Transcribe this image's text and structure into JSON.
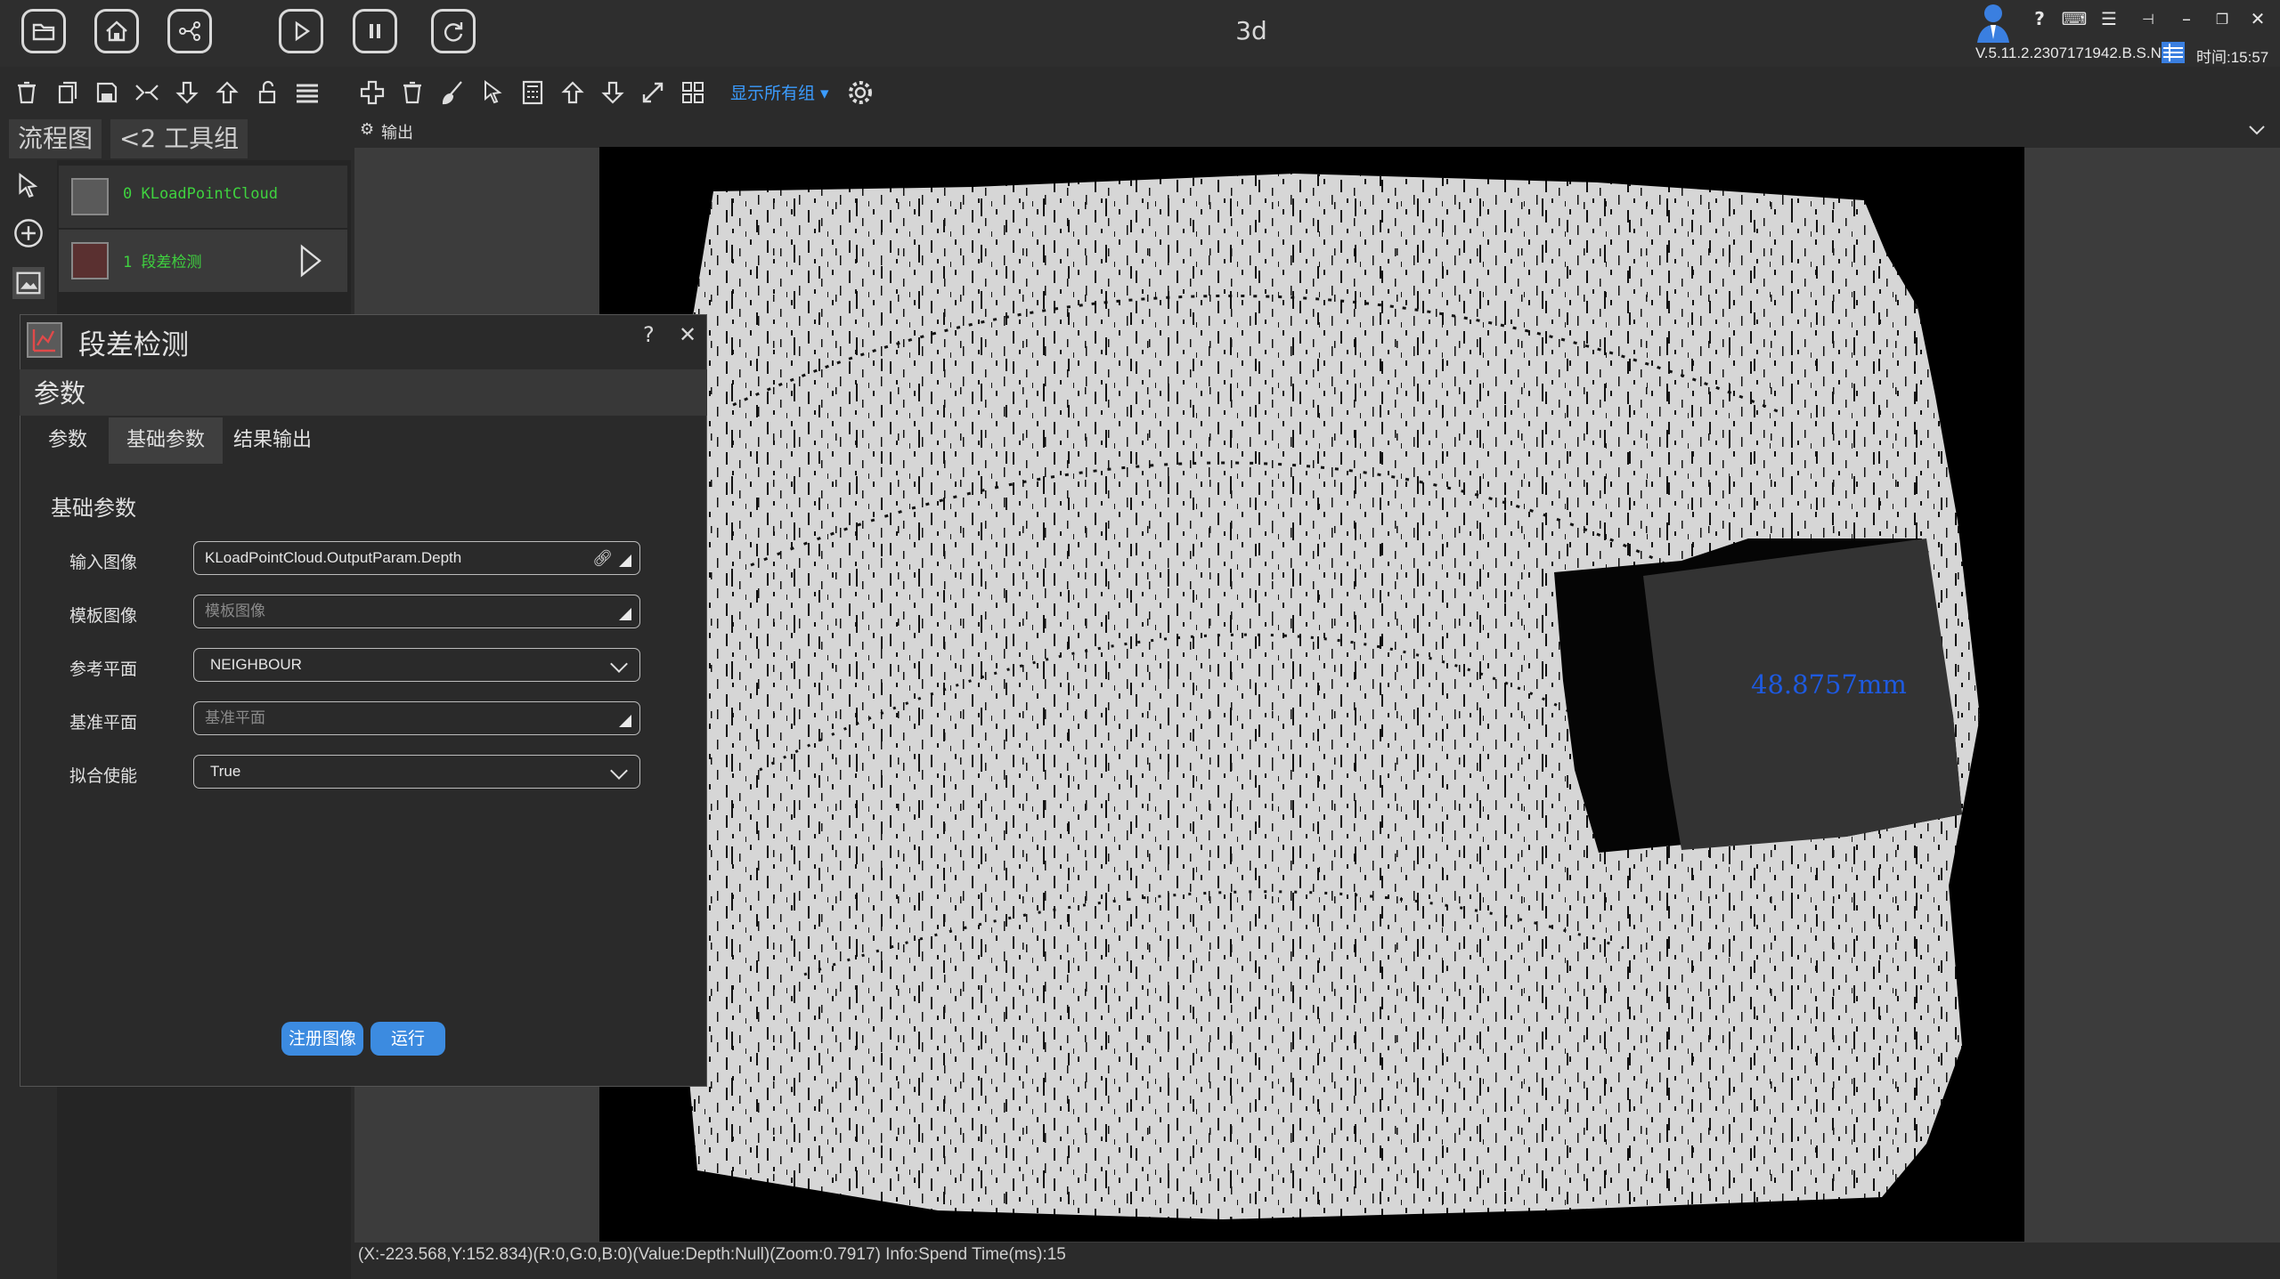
{
  "app": {
    "title": "3d",
    "version": "V.5.11.2.2307171942.B.S.N",
    "clock": "时间:15:57",
    "help_label": "?"
  },
  "toolbar": {
    "show_groups_label": "显示所有组"
  },
  "left_tabs": {
    "flow_label": "流程图",
    "toolgroup_label": "<2  工具组"
  },
  "flow_nodes": [
    {
      "label": "0 KLoadPointCloud"
    },
    {
      "label": "1 段差检测"
    }
  ],
  "output_panel": {
    "title": "输出",
    "measurement_label": "48.8757mm",
    "status": "(X:-223.568,Y:152.834)(R:0,G:0,B:0)(Value:Depth:Null)(Zoom:0.7917)  Info:Spend Time(ms):15"
  },
  "dialog": {
    "title": "段差检测",
    "help": "?",
    "close": "✕",
    "section_label": "参数",
    "tabs": [
      "参数",
      "基础参数",
      "结果输出"
    ],
    "active_tab": "基础参数",
    "group_title": "基础参数",
    "params": [
      {
        "label": "输入图像",
        "value": "KLoadPointCloud.OutputParam.Depth",
        "placeholder": ""
      },
      {
        "label": "模板图像",
        "value": "",
        "placeholder": "模板图像"
      },
      {
        "label": "参考平面",
        "value": "NEIGHBOUR",
        "placeholder": ""
      },
      {
        "label": "基准平面",
        "value": "",
        "placeholder": "基准平面"
      },
      {
        "label": "拟合使能",
        "value": "True",
        "placeholder": ""
      }
    ],
    "register_button": "注册图像",
    "run_button": "运行"
  },
  "colors": {
    "accent": "#3c8be0",
    "node_label": "#3fd23f",
    "link": "#3b9cff",
    "measurement": "#1e5ae0"
  }
}
